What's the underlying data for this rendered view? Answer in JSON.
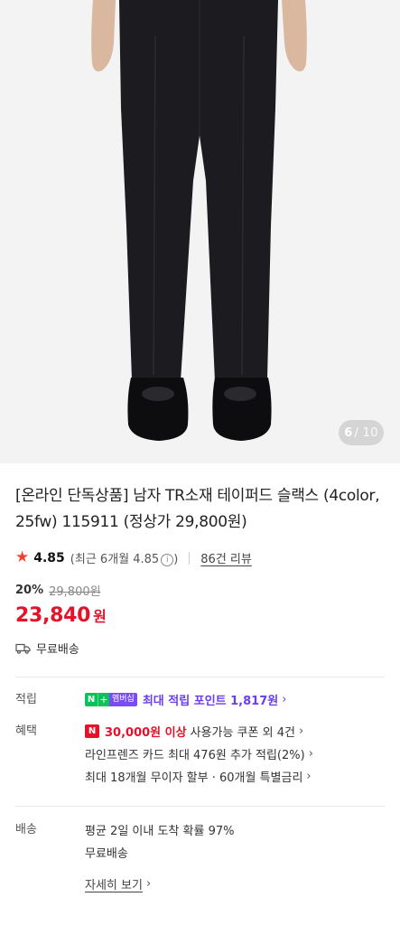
{
  "image": {
    "counter_current": "6",
    "counter_total": "/ 10"
  },
  "product": {
    "title": "[온라인 단독상품] 남자 TR소재 테이퍼드 슬랙스 (4color, 25fw) 115911 (정상가 29,800원)",
    "rating": "4.85",
    "rating_recent": "(최근 6개월 4.85",
    "rating_recent_close": ")",
    "reviews_label": "86건 리뷰",
    "discount_rate": "20%",
    "original_price": "29,800원",
    "price": "23,840",
    "currency": "원",
    "shipping_label": "무료배송"
  },
  "benefits": {
    "points": {
      "label": "적립",
      "badge_n": "N",
      "badge_plus": "+",
      "badge_member": "멤버십",
      "text": "최대 적립 포인트 1,817원",
      "chevron": "›"
    },
    "offers": {
      "label": "혜택",
      "coupon_badge": "N",
      "coupon_amount": "30,000원 이상",
      "coupon_text": "사용가능 쿠폰 외 4건",
      "card_text": "라인프렌즈 카드 최대 476원 추가 적립(2%)",
      "installment_text": "최대 18개월 무이자 할부 · 60개월 특별금리",
      "chevron": "›"
    },
    "delivery": {
      "label": "배송",
      "arrival_text": "평균 2일 이내 도착 확률 97%",
      "free_text": "무료배송",
      "detail_link": "자세히 보기",
      "chevron": "›"
    }
  },
  "colors": {
    "sale_red": "#e5122a",
    "point_purple": "#6b3df0",
    "naver_green": "#09c35a",
    "star": "#f0432d"
  }
}
